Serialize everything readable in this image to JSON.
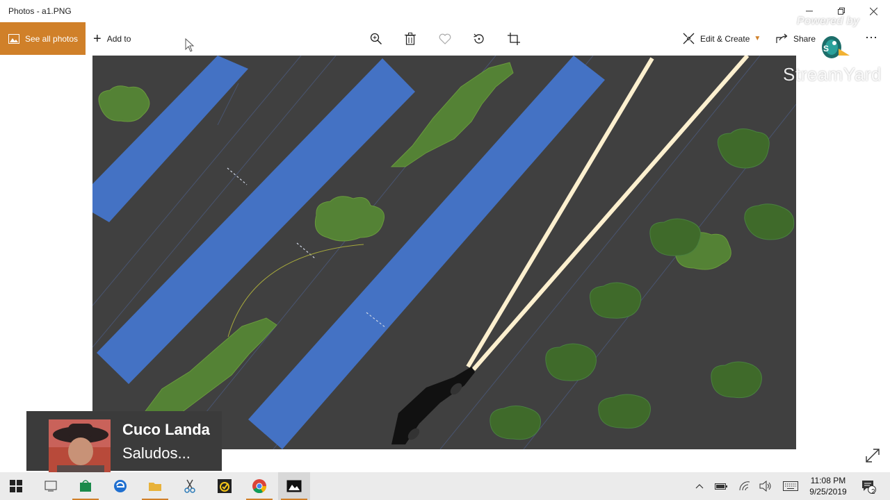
{
  "window": {
    "title": "Photos - a1.PNG"
  },
  "toolbar": {
    "see_all_photos": "See all photos",
    "add_to": "Add to",
    "edit_create": "Edit & Create",
    "share": "Share",
    "more": "⋯",
    "icons": [
      "zoom-icon",
      "delete-icon",
      "favorite-icon",
      "rotate-icon",
      "crop-icon"
    ]
  },
  "overlay": {
    "powered_by": "Powered by",
    "brand": "StreamYard"
  },
  "banner": {
    "name": "Cuco Landa",
    "message": "Saludos..."
  },
  "clock": {
    "time": "11:08 PM",
    "date": "9/25/2019"
  },
  "notifications": {
    "count": "2"
  },
  "colors": {
    "accent": "#d08029",
    "canvas_bg": "#404040",
    "lane_blue": "#4472c4",
    "bush_green": "#548235",
    "beam": "#fdf0cf"
  }
}
